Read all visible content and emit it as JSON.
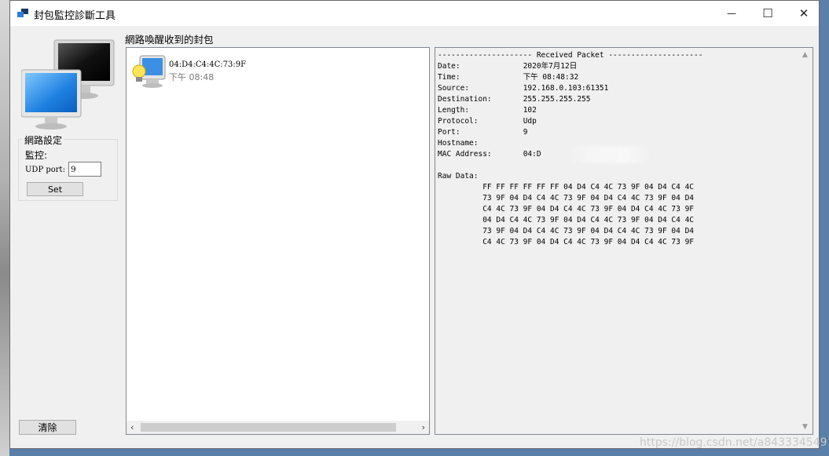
{
  "window": {
    "title": "封包監控診斷工具",
    "minimize": "—",
    "maximize": "☐",
    "close": "✕"
  },
  "section_label": "網路喚醒收到的封包",
  "network_settings": {
    "legend": "網路設定",
    "monitor_label": "監控:",
    "port_label": "UDP port:",
    "port_value": "9",
    "set_button": "Set"
  },
  "clear_button": "清除",
  "packet_list": [
    {
      "mac": "04:D4:C4:4C:73:9F",
      "time": "下午 08:48"
    }
  ],
  "packet_detail": {
    "header": "--------------------- Received Packet ---------------------",
    "fields": [
      {
        "label": "Date:",
        "value": "2020年7月12日"
      },
      {
        "label": "Time:",
        "value": "下午 08:48:32"
      },
      {
        "label": "Source:",
        "value": "192.168.0.103:61351"
      },
      {
        "label": "Destination:",
        "value": "255.255.255.255"
      },
      {
        "label": "Length:",
        "value": "102"
      },
      {
        "label": "Protocol:",
        "value": "Udp"
      },
      {
        "label": "Port:",
        "value": "9"
      },
      {
        "label": "Hostname:",
        "value": ""
      },
      {
        "label": "MAC Address:",
        "value": "04:D"
      }
    ],
    "raw_label": "Raw Data:",
    "raw_lines": [
      "FF FF FF FF FF FF 04 D4 C4 4C 73 9F 04 D4 C4 4C",
      "73 9F 04 D4 C4 4C 73 9F 04 D4 C4 4C 73 9F 04 D4",
      "C4 4C 73 9F 04 D4 C4 4C 73 9F 04 D4 C4 4C 73 9F",
      "04 D4 C4 4C 73 9F 04 D4 C4 4C 73 9F 04 D4 C4 4C",
      "73 9F 04 D4 C4 4C 73 9F 04 D4 C4 4C 73 9F 04 D4",
      "C4 4C 73 9F 04 D4 C4 4C 73 9F 04 D4 C4 4C 73 9F"
    ]
  },
  "watermark": "https://blog.csdn.net/a843334549"
}
